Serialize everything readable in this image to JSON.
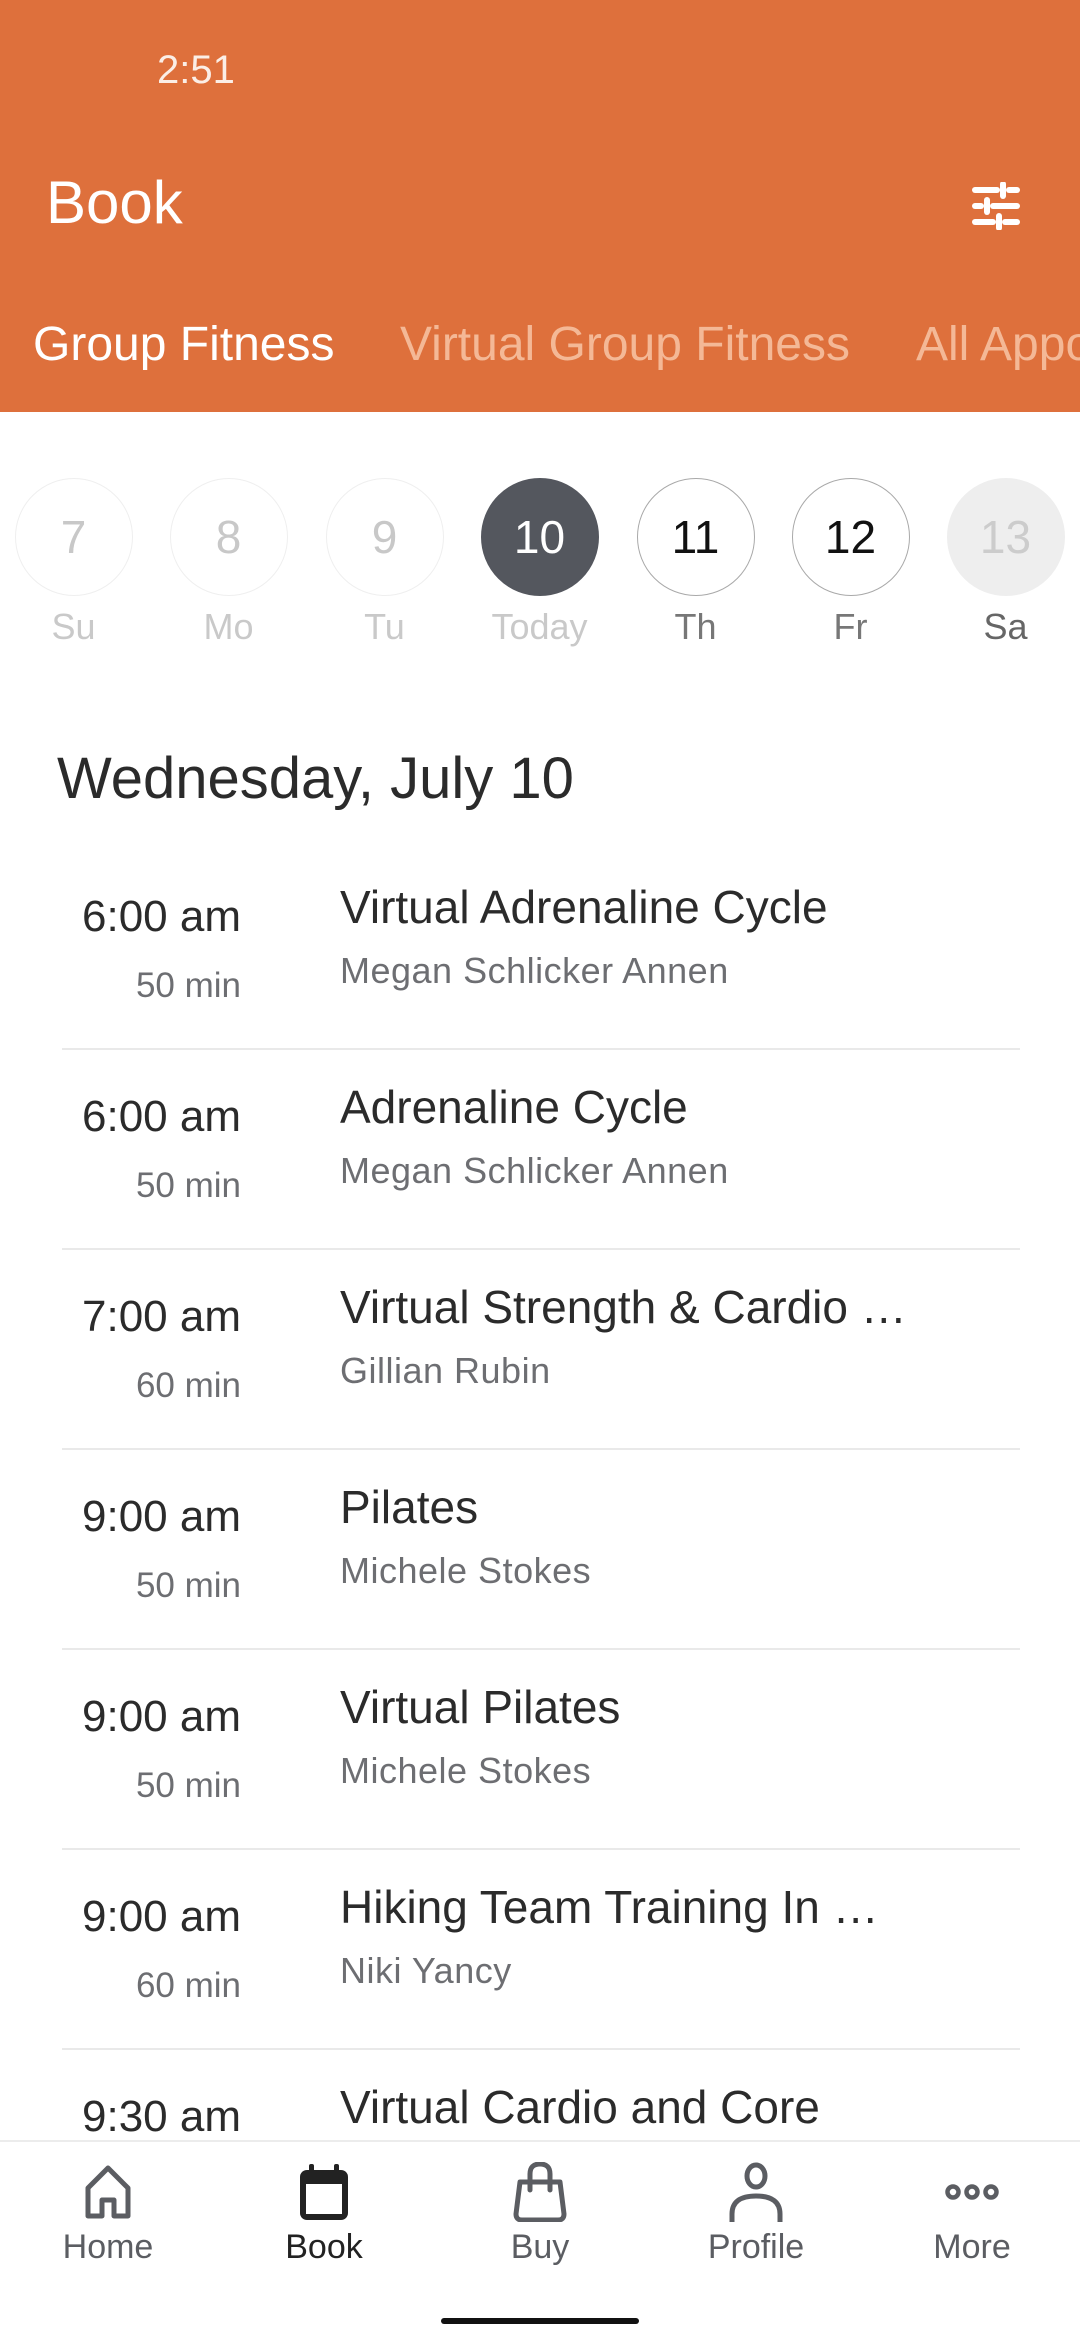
{
  "status_bar": {
    "time": "2:51"
  },
  "header": {
    "title": "Book",
    "filter_icon": "sliders-icon",
    "background_color": "#de703c",
    "tabs": [
      {
        "label": "Group Fitness",
        "active": true
      },
      {
        "label": "Virtual Group Fitness",
        "active": false
      },
      {
        "label": "All Appo",
        "active": false
      }
    ]
  },
  "date_strip": [
    {
      "day": "7",
      "label": "Su",
      "state": "past"
    },
    {
      "day": "8",
      "label": "Mo",
      "state": "past"
    },
    {
      "day": "9",
      "label": "Tu",
      "state": "past"
    },
    {
      "day": "10",
      "label": "Today",
      "state": "selected"
    },
    {
      "day": "11",
      "label": "Th",
      "state": "available"
    },
    {
      "day": "12",
      "label": "Fr",
      "state": "available"
    },
    {
      "day": "13",
      "label": "Sa",
      "state": "unavailable"
    }
  ],
  "schedule": {
    "heading": "Wednesday, July 10",
    "classes": [
      {
        "time": "6:00 am",
        "duration": "50 min",
        "title": "Virtual Adrenaline Cycle",
        "instructor": "Megan Schlicker Annen"
      },
      {
        "time": "6:00 am",
        "duration": "50 min",
        "title": "Adrenaline Cycle",
        "instructor": "Megan Schlicker Annen"
      },
      {
        "time": "7:00 am",
        "duration": "60 min",
        "title": "Virtual Strength & Cardio …",
        "instructor": "Gillian Rubin"
      },
      {
        "time": "9:00 am",
        "duration": "50 min",
        "title": "Pilates",
        "instructor": "Michele Stokes"
      },
      {
        "time": "9:00 am",
        "duration": "50 min",
        "title": "Virtual Pilates",
        "instructor": "Michele Stokes"
      },
      {
        "time": "9:00 am",
        "duration": "60 min",
        "title": "Hiking Team Training In …",
        "instructor": "Niki Yancy"
      },
      {
        "time": "9:30 am",
        "duration": "",
        "title": "Virtual Cardio and Core",
        "instructor": ""
      }
    ]
  },
  "bottom_nav": {
    "items": [
      {
        "label": "Home",
        "icon": "home-icon",
        "active": false
      },
      {
        "label": "Book",
        "icon": "calendar-icon",
        "active": true
      },
      {
        "label": "Buy",
        "icon": "shopping-bag-icon",
        "active": false
      },
      {
        "label": "Profile",
        "icon": "person-icon",
        "active": false
      },
      {
        "label": "More",
        "icon": "more-dots-icon",
        "active": false
      }
    ]
  }
}
